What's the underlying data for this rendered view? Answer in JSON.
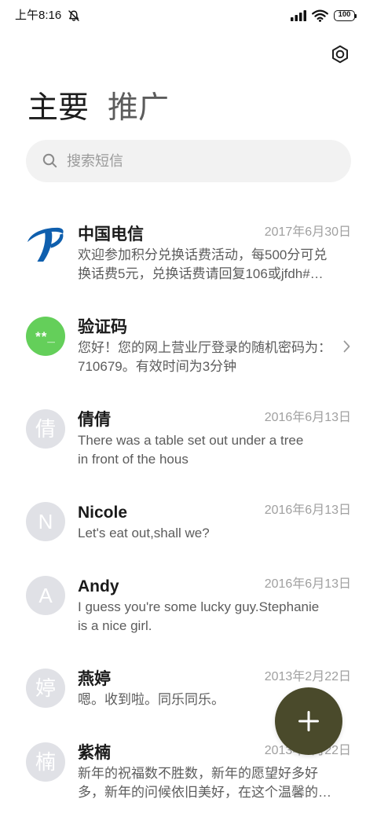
{
  "status_bar": {
    "time": "上午8:16",
    "battery_level": "100",
    "icons": {
      "notification": "bell-off-icon",
      "signal": "signal-icon",
      "wifi": "wifi-icon",
      "battery": "battery-icon"
    }
  },
  "header": {
    "settings_icon": "settings-icon",
    "tabs": [
      {
        "label": "主要",
        "selected": true
      },
      {
        "label": "推广",
        "selected": false
      }
    ]
  },
  "search": {
    "placeholder": "搜索短信",
    "icon": "search-icon"
  },
  "conversations": [
    {
      "name": "中国电信",
      "date": "2017年6月30日",
      "avatar": {
        "icon": "china-telecom-logo-icon",
        "color": "#0f5fae"
      },
      "preview": [
        "欢迎参加积分兑换话费活动，每500分可兑",
        "换话费5元，兑换话费请回复106或jfdh#…"
      ]
    },
    {
      "name": "验证码",
      "avatar": {
        "text": "**_",
        "color": "#64cf5a"
      },
      "preview": [
        "您好！您的网上营业厅登录的随机密码为：",
        "710679。有效时间为3分钟"
      ],
      "trailing_icon": "chevron-right-icon"
    },
    {
      "name": "倩倩",
      "date": "2016年6月13日",
      "avatar": {
        "text": "倩",
        "color": "#e0e1e6"
      },
      "preview": [
        "There was a table set out under a tree",
        "in front of the hous"
      ]
    },
    {
      "name": "Nicole",
      "date": "2016年6月13日",
      "avatar": {
        "text": "N",
        "color": "#e0e1e6"
      },
      "preview": [
        "Let's eat out,shall we?"
      ]
    },
    {
      "name": "Andy",
      "date": "2016年6月13日",
      "avatar": {
        "text": "A",
        "color": "#e0e1e6"
      },
      "preview": [
        "I guess you're some lucky guy.Stephanie",
        "is a nice girl."
      ]
    },
    {
      "name": "燕婷",
      "date": "2013年2月22日",
      "avatar": {
        "text": "婷",
        "color": "#e0e1e6"
      },
      "preview": [
        "嗯。收到啦。同乐同乐。"
      ]
    },
    {
      "name": "紫楠",
      "date": "2013年2月22日",
      "avatar": {
        "text": "楠",
        "color": "#e0e1e6"
      },
      "preview": [
        "新年的祝福数不胜数，新年的愿望好多好",
        "多，新年的问候依旧美好，在这个温馨的…"
      ]
    }
  ],
  "compose_button": {
    "icon": "plus-icon",
    "color": "#4a4a2b"
  },
  "theme": {
    "background": "#ffffff",
    "title_text": "#1a1a1a",
    "preview_text": "#5c5c5c",
    "date_text": "#a0a0a0",
    "search_background": "#f2f2f2"
  }
}
